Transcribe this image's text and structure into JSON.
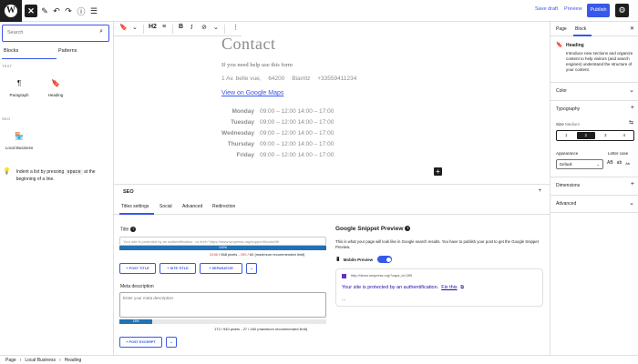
{
  "topbar": {
    "logo_glyph": "W",
    "close_glyph": "✕",
    "tools_glyph": "✎",
    "undo_glyph": "↶",
    "redo_glyph": "↷",
    "info_glyph": "ⓘ",
    "list_glyph": "☰",
    "save_draft": "Save draft",
    "preview": "Preview",
    "publish": "Publish",
    "settings_glyph": "⚙"
  },
  "block_toolbar": {
    "bookmark_glyph": "🔖",
    "updown_glyph": "⌄",
    "heading_level": "H2",
    "align_glyph": "≡",
    "bold": "B",
    "italic": "I",
    "link_glyph": "⊘",
    "more_glyph": "⌄",
    "options_glyph": "⋮"
  },
  "inserter": {
    "search_placeholder": "Search",
    "search_glyph": "⌕",
    "tabs": [
      "Blocks",
      "Patterns"
    ],
    "categories": [
      {
        "label": "TEXT",
        "items": [
          {
            "icon": "¶",
            "label": "Paragraph"
          },
          {
            "icon": "🔖",
            "label": "Heading"
          }
        ]
      },
      {
        "label": "SEO",
        "items": [
          {
            "icon": "🏪",
            "label": "Local Business"
          }
        ]
      }
    ],
    "tip_icon": "💡",
    "tip_before": "Indent a list by pressing ",
    "tip_key": "space",
    "tip_after": " at the beginning of a line."
  },
  "content": {
    "title": "Contact",
    "help_line": "If you need help use this form",
    "address": [
      "1 Av. belle vue,",
      "64200",
      "Biarritz",
      "+33559411234"
    ],
    "map_link": "View on Google Maps",
    "hours": [
      {
        "day": "Monday",
        "time": "09:00 – 12:00 14:00 – 17:00"
      },
      {
        "day": "Tuesday",
        "time": "09:00 – 12:00 14:00 – 17:00"
      },
      {
        "day": "Wednesday",
        "time": "09:00 – 12:00 14:00 – 17:00"
      },
      {
        "day": "Thursday",
        "time": "09:00 – 12:00 14:00 – 17:00"
      },
      {
        "day": "Friday",
        "time": "09:00 – 12:00 14:00 – 17:00"
      }
    ],
    "add_block_glyph": "+"
  },
  "seo": {
    "heading": "SEO",
    "caret": "+",
    "tabs": [
      "Titles settings",
      "Social",
      "Advanced",
      "Redirection"
    ],
    "title_label": "Title",
    "help_glyph": "?",
    "title_value": "Your site is protected by an authentification. <a href=\"https://www.seopress.org/support/hooks/filt",
    "title_progress": 100,
    "title_progress_label": "100%",
    "title_counter_red": "2436",
    "title_counter_pixels": "568 pixels",
    "title_counter_red2": "290",
    "title_counter_limit": "60",
    "title_counter_rest": "(maximum recommended limit)",
    "tag_buttons": [
      "+ POST TITLE",
      "+ SITE TITLE",
      "+ SEPARATOR"
    ],
    "more_tags_glyph": "⌄",
    "meta_label": "Meta description",
    "meta_placeholder": "Enter your meta description",
    "meta_progress": 16,
    "meta_progress_label": "16%",
    "meta_counter": "172 / 940 pixels - 27 / 160 (maximum recommended limit)",
    "excerpt_button": "+ POST EXCERPT",
    "snippet": {
      "title": "Google Snippet Preview",
      "description": "This is what your page will look like in Google search results. You have to publish your post to get the Google Snippet Preview.",
      "mobile_label": "Mobile Preview",
      "mobile_glyph": "📱",
      "url": "http://demo.seopress.org/?capa_id=289",
      "headline": "Your site is protected by an authentification.",
      "headline_link": "Fix this",
      "external_glyph": "⧉",
      "dots": "..."
    }
  },
  "sidebar": {
    "tabs": [
      "Page",
      "Block"
    ],
    "close_glyph": "✕",
    "block_icon": "🔖",
    "block_name": "Heading",
    "block_desc": "Introduce new sections and organize content to help visitors (and search engines) understand the structure of your content.",
    "sections": [
      "Color",
      "Typography"
    ],
    "collapsed_icon": "⌄",
    "expand_icon": "+",
    "size_label": "Size",
    "size_value": "Medium",
    "size_settings_glyph": "⇆",
    "size_options": [
      "1",
      "2",
      "3",
      "4"
    ],
    "size_active": "2",
    "appearance_label": "Appearance",
    "appearance_value": "Default",
    "appearance_caret": "⌄",
    "lettercase_label": "Letter case",
    "lettercase_options": [
      "AB",
      "ab",
      "Ab"
    ],
    "bottom_sections": [
      "Dimensions",
      "Advanced"
    ],
    "dimensions_icon": "+",
    "advanced_icon": "⌄"
  },
  "breadcrumb": {
    "items": [
      "Page",
      "Local Business",
      "Heading"
    ],
    "sep": "›"
  }
}
